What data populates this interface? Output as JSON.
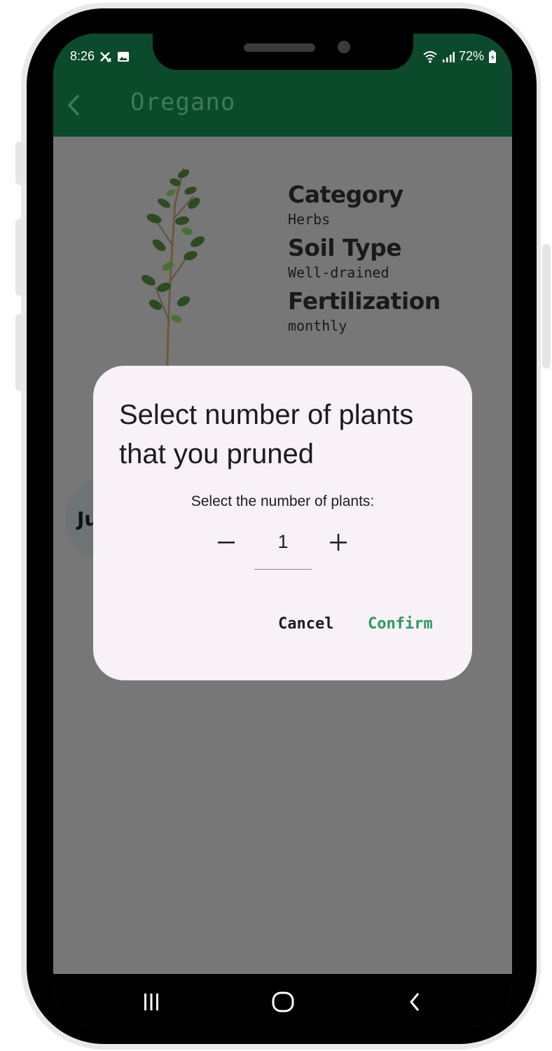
{
  "status_bar": {
    "time": "8:26",
    "battery": "72%"
  },
  "app_bar": {
    "title": "Oregano"
  },
  "plant_info": {
    "fields": [
      {
        "label": "Category",
        "value": "Herbs"
      },
      {
        "label": "Soil Type",
        "value": "Well-drained"
      },
      {
        "label": "Fertilization",
        "value": "monthly"
      }
    ]
  },
  "background_partial_label": "Ju",
  "dialog": {
    "title": "Select number of plants that you pruned",
    "subtitle": "Select the number of plants:",
    "value": "1",
    "minus_symbol": "−",
    "plus_symbol": "+",
    "cancel_label": "Cancel",
    "confirm_label": "Confirm"
  },
  "colors": {
    "app_bar": "#0c4a2c",
    "scrim_background": "#777777",
    "dialog_background": "#f8f2f8",
    "confirm_accent": "#2e9a64"
  },
  "icons": {
    "back": "chevron-left-icon",
    "nav_recents": "recents-icon",
    "nav_home": "home-icon",
    "nav_back": "nav-back-icon"
  }
}
